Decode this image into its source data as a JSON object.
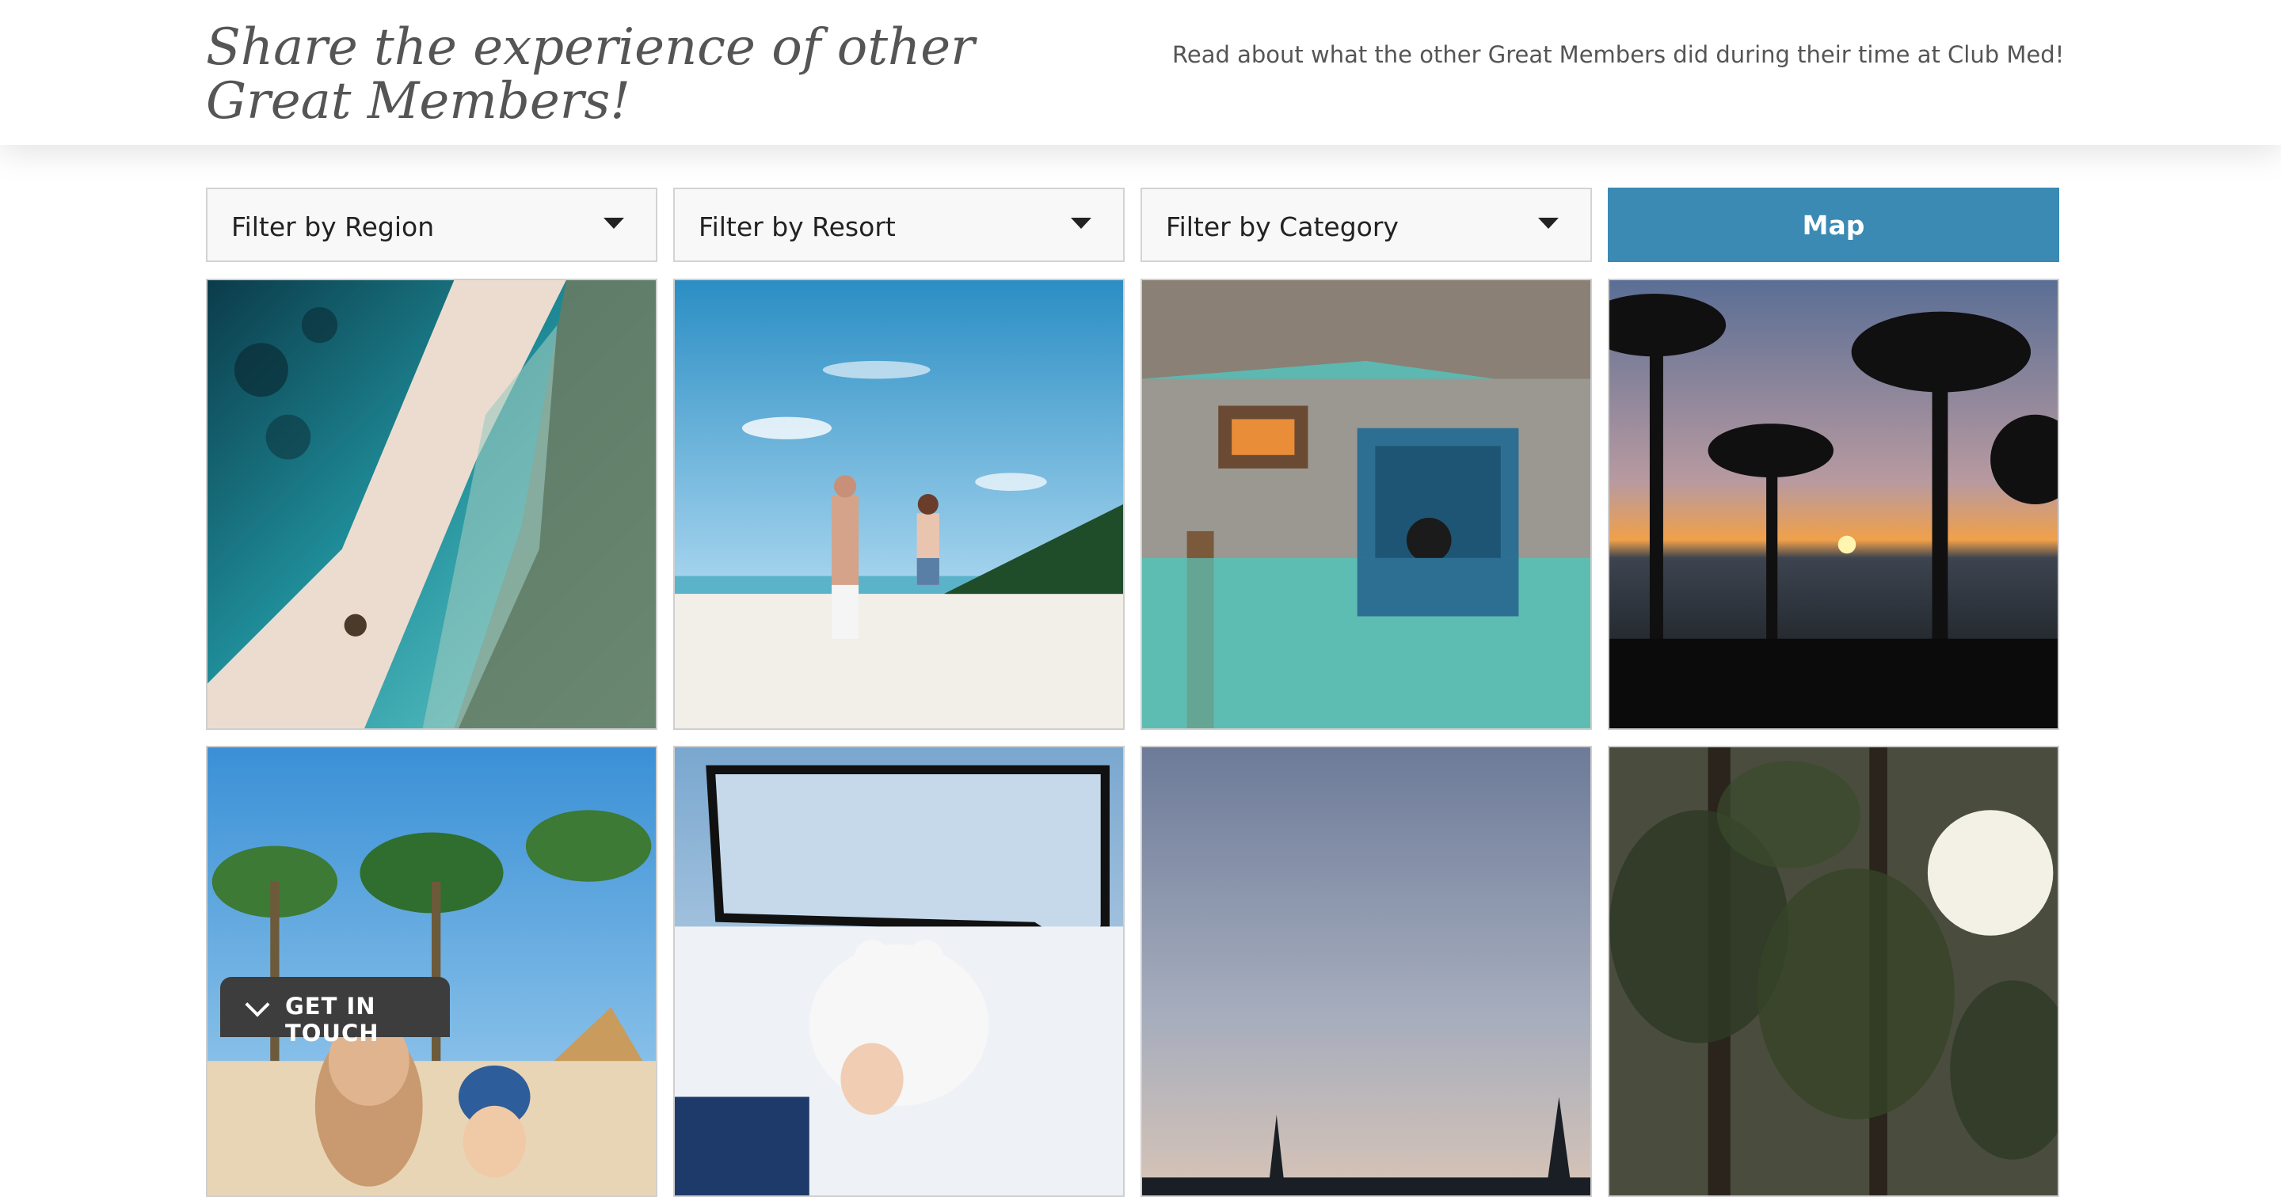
{
  "header": {
    "title": "Share the experience of other Great Members!",
    "subtitle": "Read about what the other Great Members did during their time at Club Med!"
  },
  "filters": [
    {
      "label": "Filter by Region"
    },
    {
      "label": "Filter by Resort"
    },
    {
      "label": "Filter by Category"
    }
  ],
  "map_button": {
    "label": "Map",
    "color": "#3a8ab4"
  },
  "floating_button": {
    "label": "GET IN TOUCH"
  },
  "icons": [
    "caret-down-icon",
    "chevron-down-icon"
  ]
}
